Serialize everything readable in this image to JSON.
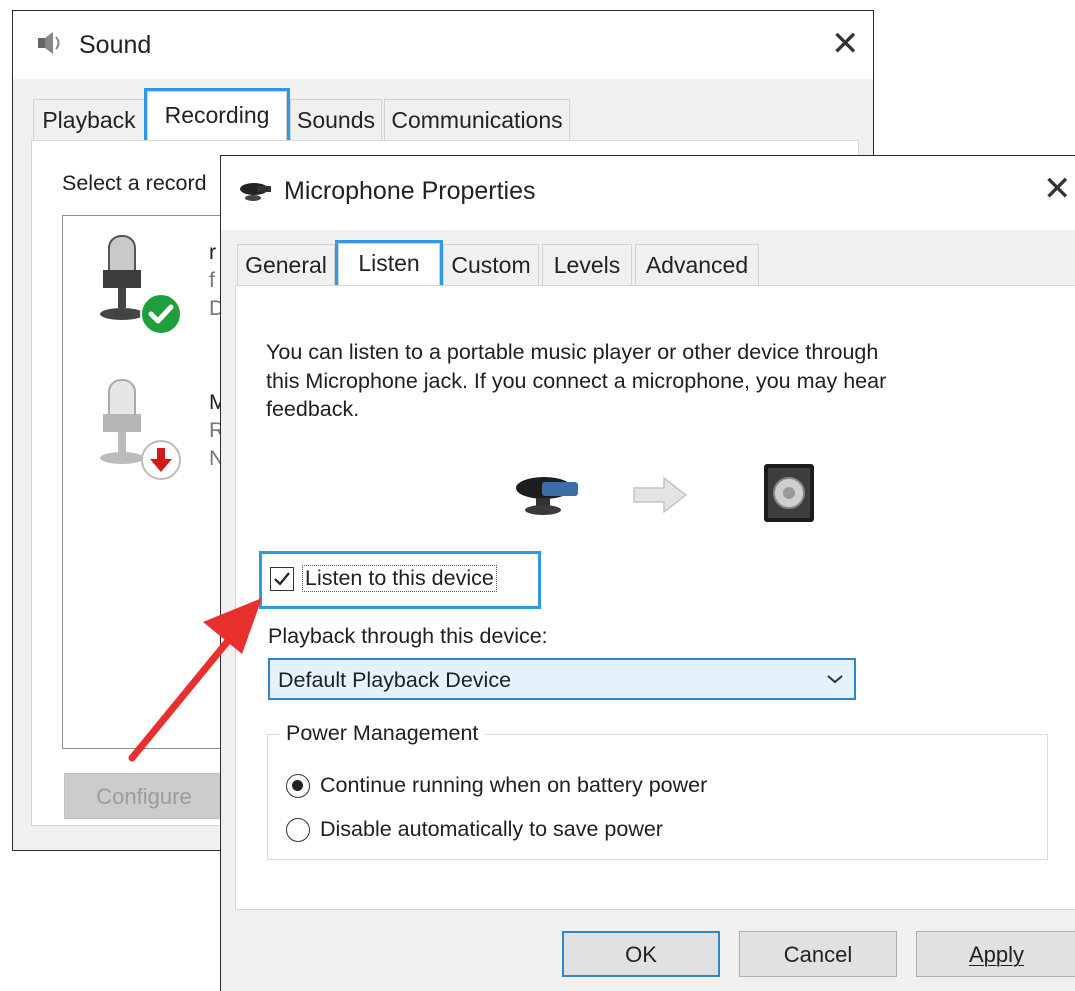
{
  "sound_window": {
    "title": "Sound",
    "tabs": [
      "Playback",
      "Recording",
      "Sounds",
      "Communications"
    ],
    "selected_tab": "Recording",
    "prompt_text": "Select a record",
    "devices": [
      {
        "line1": "r",
        "line2": "f",
        "line3": "D",
        "status": "default-check"
      },
      {
        "line1": "M",
        "line2": "R",
        "line3": "N",
        "status": "disabled-down-arrow"
      }
    ],
    "configure_label": "Configure"
  },
  "props_window": {
    "title": "Microphone Properties",
    "tabs": [
      "General",
      "Listen",
      "Custom",
      "Levels",
      "Advanced"
    ],
    "selected_tab": "Listen",
    "description": [
      "You can listen to a portable music player or other device through",
      "this Microphone jack.  If you connect a microphone, you may hear",
      "feedback."
    ],
    "listen_checkbox_label": "Listen to this device",
    "listen_checked": true,
    "playback_label": "Playback through this device:",
    "playback_value": "Default Playback Device",
    "power_group_label": "Power Management",
    "power_options": [
      "Continue running when on battery power",
      "Disable automatically to save power"
    ],
    "power_selected": 0,
    "buttons": {
      "ok": "OK",
      "cancel": "Cancel",
      "apply": "Apply"
    }
  },
  "colors": {
    "highlight": "#2f9ae0",
    "annotation_arrow": "#e8312f",
    "default_check": "#1f9e3c",
    "disabled_arrow": "#d11a1a"
  }
}
